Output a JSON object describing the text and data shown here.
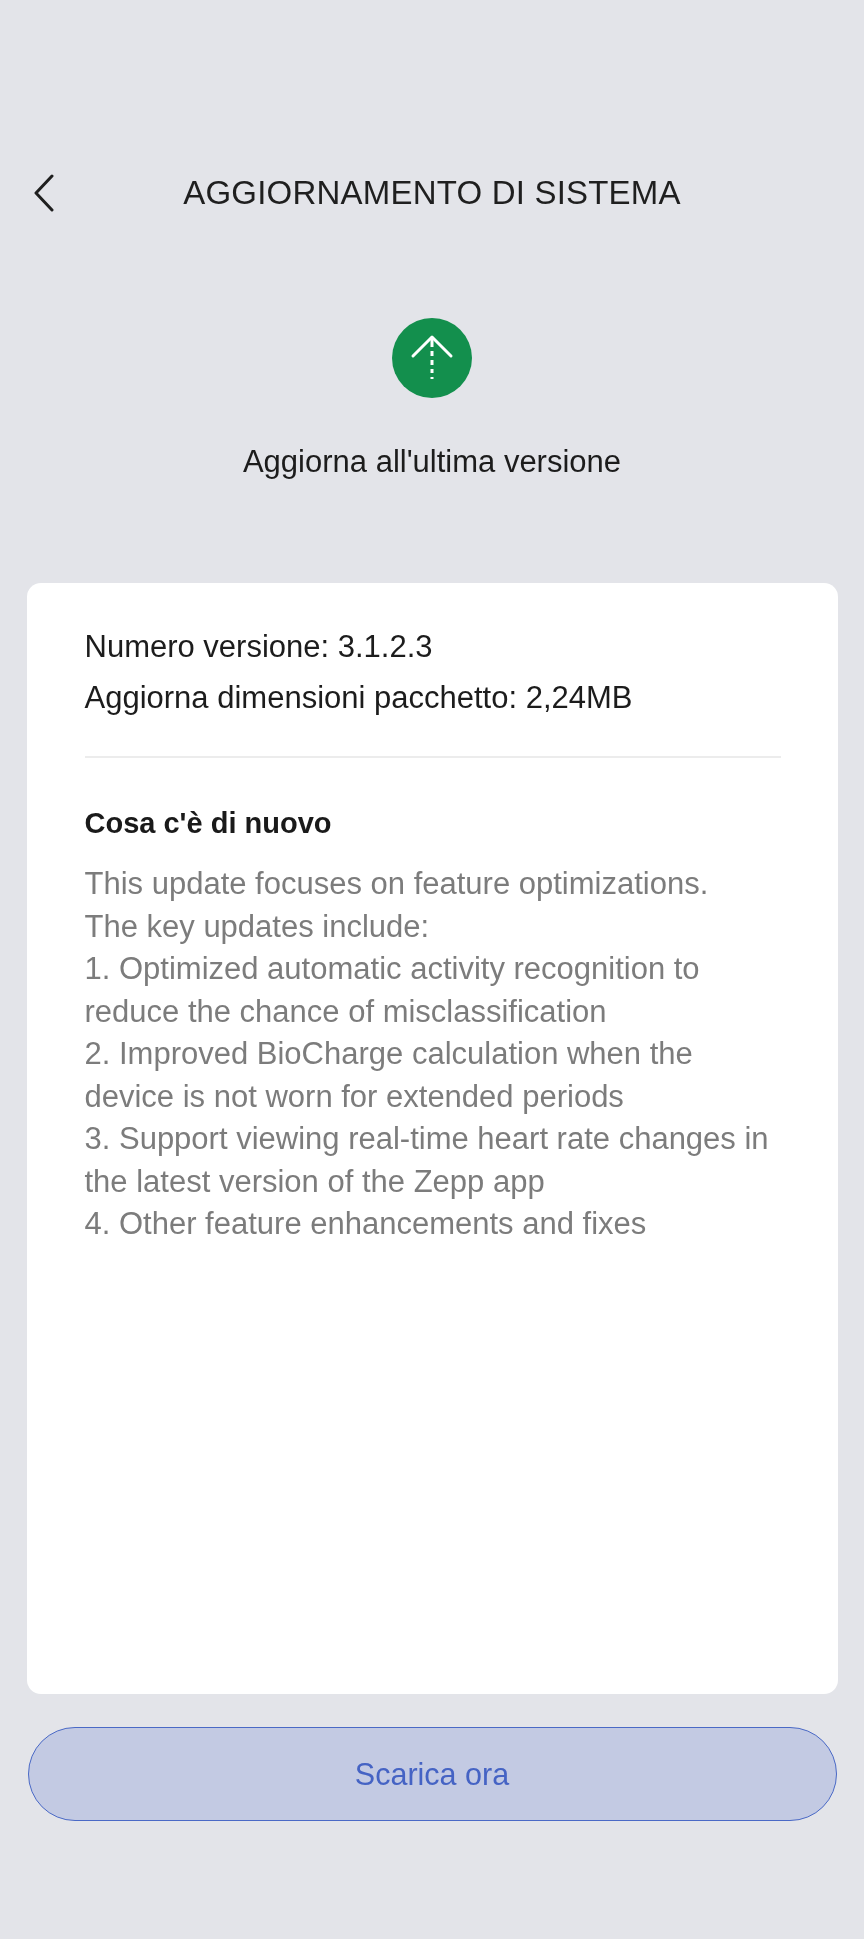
{
  "header": {
    "title": "AGGIORNAMENTO DI SISTEMA"
  },
  "status": {
    "message": "Aggiorna all'ultima versione"
  },
  "details": {
    "version": "Numero versione: 3.1.2.3",
    "package_size": "Aggiorna dimensioni pacchetto: 2,24MB"
  },
  "whats_new": {
    "heading": "Cosa c'è di nuovo",
    "lines": [
      "This update focuses on feature optimizations.",
      "The key updates include:",
      "1. Optimized automatic activity recognition to reduce the chance of misclassification",
      "2. Improved BioCharge calculation when the device is not worn for extended periods",
      "3. Support viewing real-time heart rate changes in the latest version of the Zepp app",
      "4. Other feature enhancements and fixes"
    ]
  },
  "download_button": {
    "label": "Scarica ora"
  }
}
